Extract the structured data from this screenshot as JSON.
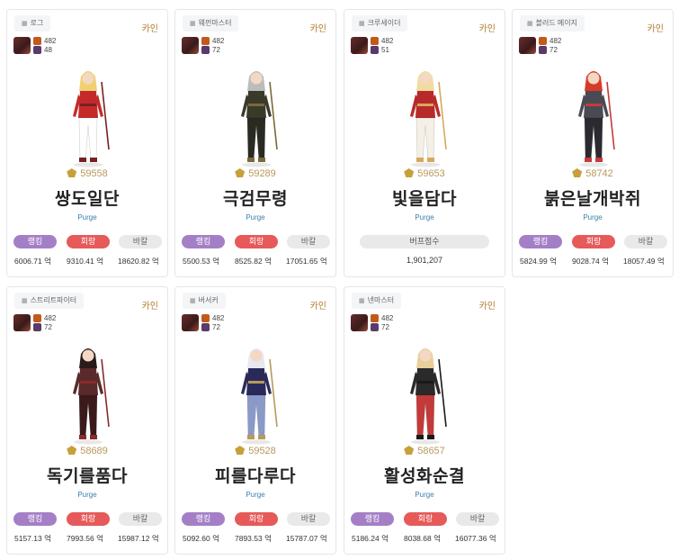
{
  "cards": [
    {
      "job": "로그",
      "server": "카인",
      "stat_a": "482",
      "stat_b": "48",
      "fame": "59558",
      "name": "쌍도일단",
      "guild": "Purge",
      "type": "dealer",
      "rank_label": "랭킹",
      "hoe_label": "회랑",
      "bak_label": "바칼",
      "rank_val": "6006.71 억",
      "hoe_val": "9310.41 억",
      "bak_val": "18620.82 억",
      "colors": {
        "hair": "#f0d070",
        "top": "#c42a2a",
        "bottom": "#ffffff",
        "accent": "#7a2020"
      }
    },
    {
      "job": "웨펀마스터",
      "server": "카인",
      "stat_a": "482",
      "stat_b": "72",
      "fame": "59289",
      "name": "극검무령",
      "guild": "Purge",
      "type": "dealer",
      "rank_label": "랭킹",
      "hoe_label": "회랑",
      "bak_label": "바칼",
      "rank_val": "5500.53 억",
      "hoe_val": "8525.82 억",
      "bak_val": "17051.65 억",
      "colors": {
        "hair": "#bcbcbc",
        "top": "#3a3a2a",
        "bottom": "#2a2a22",
        "accent": "#7a6a3a"
      }
    },
    {
      "job": "크루세이더",
      "server": "카인",
      "stat_a": "482",
      "stat_b": "51",
      "fame": "59653",
      "name": "빛을담다",
      "guild": "Purge",
      "type": "buffer",
      "buff_label": "버프점수",
      "buff_val": "1,901,207",
      "colors": {
        "hair": "#f0dca0",
        "top": "#b82a2a",
        "bottom": "#f4f0e6",
        "accent": "#d8a85a"
      }
    },
    {
      "job": "블러드 메이지",
      "server": "카인",
      "stat_a": "482",
      "stat_b": "72",
      "fame": "58742",
      "name": "붉은날개박쥐",
      "guild": "Purge",
      "type": "dealer",
      "rank_label": "랭킹",
      "hoe_label": "회랑",
      "bak_label": "바칼",
      "rank_val": "5824.99 억",
      "hoe_val": "9028.74 억",
      "bak_val": "18057.49 억",
      "colors": {
        "hair": "#d83a2a",
        "top": "#4a4a52",
        "bottom": "#2a2a30",
        "accent": "#c43a3a"
      }
    },
    {
      "job": "스트리트파이터",
      "server": "카인",
      "stat_a": "482",
      "stat_b": "72",
      "fame": "58689",
      "name": "독기를품다",
      "guild": "Purge",
      "type": "dealer",
      "rank_label": "랭킹",
      "hoe_label": "회랑",
      "bak_label": "바칼",
      "rank_val": "5157.13 억",
      "hoe_val": "7993.56 억",
      "bak_val": "15987.12 억",
      "colors": {
        "hair": "#2a1a1a",
        "top": "#5a2a2a",
        "bottom": "#3a1a1a",
        "accent": "#8a2a2a"
      }
    },
    {
      "job": "버서커",
      "server": "카인",
      "stat_a": "482",
      "stat_b": "72",
      "fame": "59528",
      "name": "피를다루다",
      "guild": "Purge",
      "type": "dealer",
      "rank_label": "랭킹",
      "hoe_label": "회랑",
      "bak_label": "바칼",
      "rank_val": "5092.60 억",
      "hoe_val": "7893.53 억",
      "bak_val": "15787.07 억",
      "colors": {
        "hair": "#e8e8f0",
        "top": "#2a2a5a",
        "bottom": "#8a9ac8",
        "accent": "#b89a5a"
      }
    },
    {
      "job": "넨마스터",
      "server": "카인",
      "stat_a": "482",
      "stat_b": "72",
      "fame": "58657",
      "name": "활성화순결",
      "guild": "Purge",
      "type": "dealer",
      "rank_label": "랭킹",
      "hoe_label": "회랑",
      "bak_label": "바칼",
      "rank_val": "5186.24 억",
      "hoe_val": "8038.68 억",
      "bak_val": "16077.36 억",
      "colors": {
        "hair": "#e8d09a",
        "top": "#2a2a2a",
        "bottom": "#c43a3a",
        "accent": "#1a1a1a"
      }
    }
  ]
}
